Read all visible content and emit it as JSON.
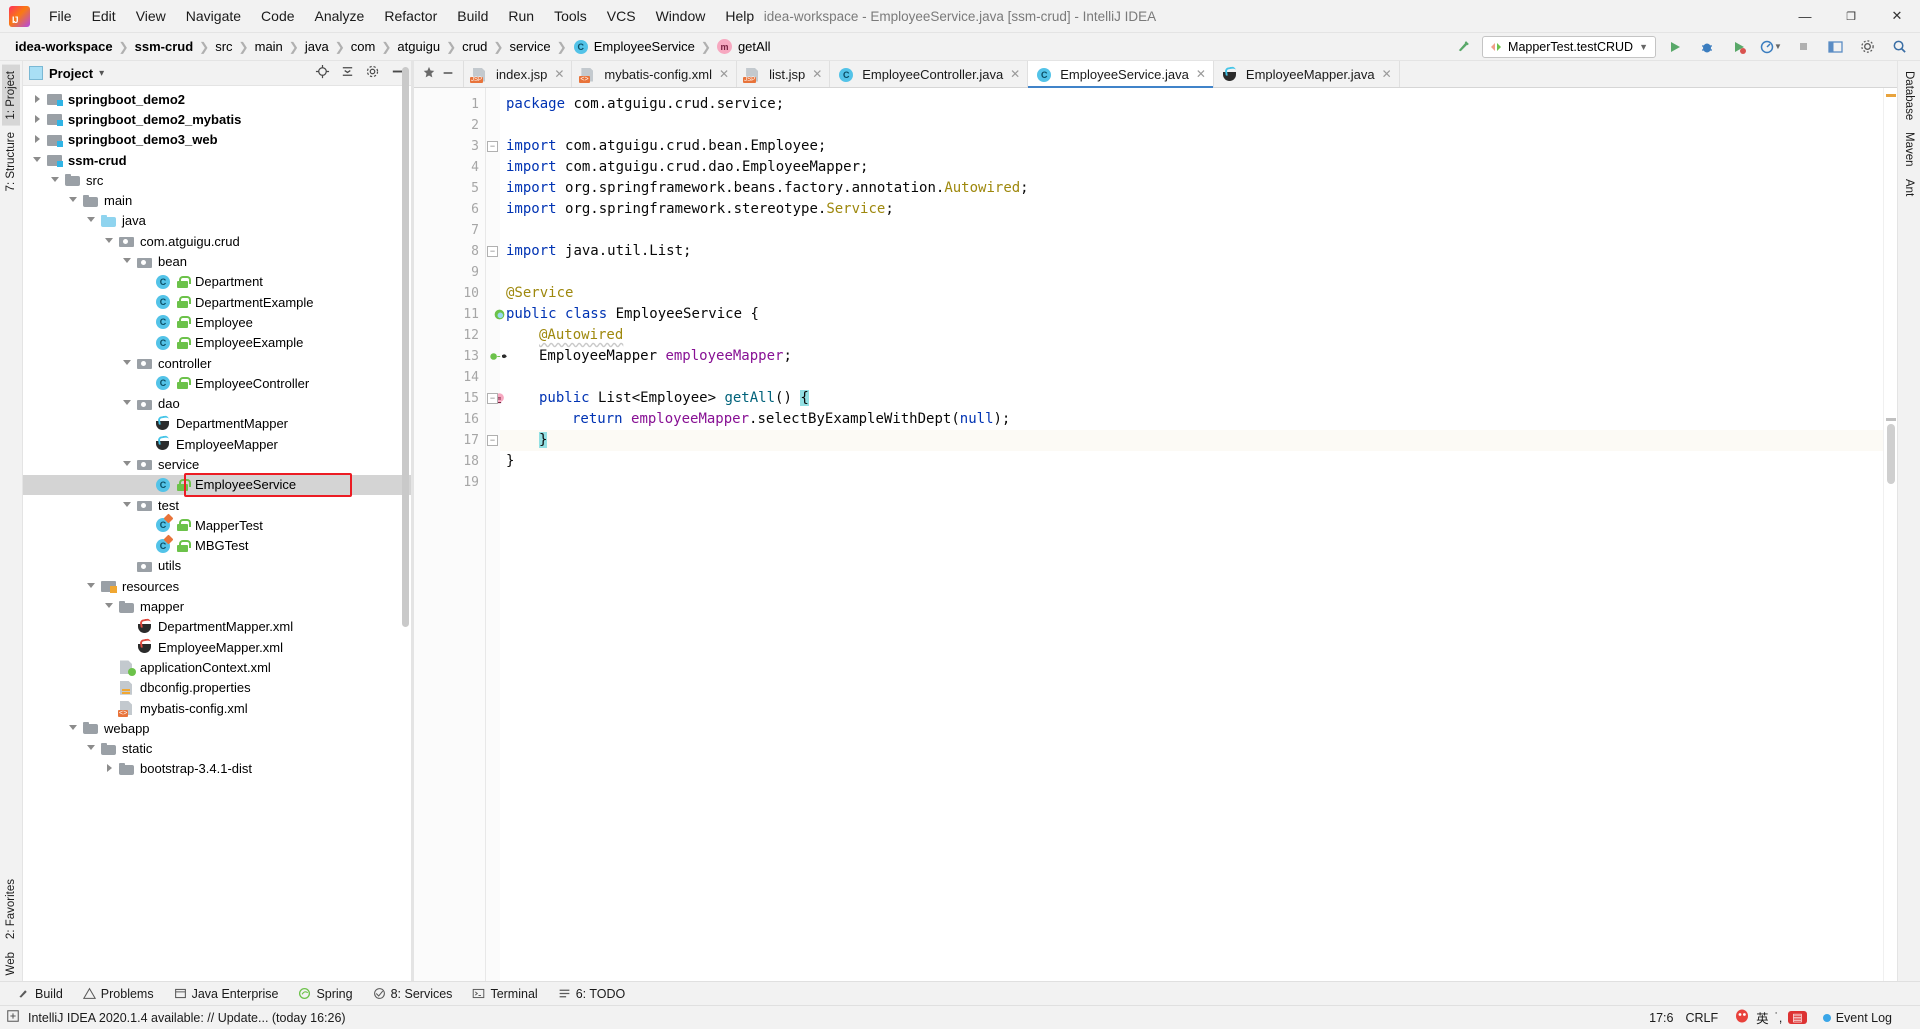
{
  "window": {
    "title": "idea-workspace - EmployeeService.java [ssm-crud] - IntelliJ IDEA",
    "minimize": "—",
    "maximize": "❐",
    "close": "✕"
  },
  "menu": [
    {
      "label": "File"
    },
    {
      "label": "Edit"
    },
    {
      "label": "View"
    },
    {
      "label": "Navigate"
    },
    {
      "label": "Code"
    },
    {
      "label": "Analyze"
    },
    {
      "label": "Refactor"
    },
    {
      "label": "Build"
    },
    {
      "label": "Run"
    },
    {
      "label": "Tools"
    },
    {
      "label": "VCS"
    },
    {
      "label": "Window"
    },
    {
      "label": "Help"
    }
  ],
  "breadcrumbs": [
    {
      "label": "idea-workspace",
      "bold": true
    },
    {
      "label": "ssm-crud",
      "bold": true
    },
    {
      "label": "src",
      "bold": false
    },
    {
      "label": "main",
      "bold": false
    },
    {
      "label": "java",
      "bold": false
    },
    {
      "label": "com",
      "bold": false
    },
    {
      "label": "atguigu",
      "bold": false
    },
    {
      "label": "crud",
      "bold": false
    },
    {
      "label": "service",
      "bold": false
    },
    {
      "label": "EmployeeService",
      "bold": false,
      "icon": "class-icon"
    },
    {
      "label": "getAll",
      "bold": false,
      "icon": "method-icon"
    }
  ],
  "toolbar": {
    "run_config": "MapperTest.testCRUD",
    "build_label": "build-icon",
    "run_label": "run-icon",
    "debug_label": "debug-icon",
    "coverage_label": "run-with-coverage-icon",
    "profile_label": "profiler-icon",
    "stop_label": "stop-icon",
    "layout_label": "layout-icon",
    "settings_label": "settings-icon",
    "search_label": "search-icon"
  },
  "left_strip": [
    {
      "label": "1: Project",
      "selected": true
    },
    {
      "label": "7: Structure",
      "selected": false
    },
    {
      "label": "2: Favorites",
      "selected": false
    },
    {
      "label": "Web",
      "selected": false
    }
  ],
  "right_strip": [
    {
      "label": "Database",
      "selected": false
    },
    {
      "label": "Maven",
      "selected": false
    },
    {
      "label": "Ant",
      "selected": false
    }
  ],
  "project_panel": {
    "title": "Project",
    "chevron": "▾",
    "locate_icon": "crosshair-icon",
    "collapse_icon": "collapse-all-icon",
    "settings_icon": "gear-icon",
    "hide_icon": "hide-icon",
    "tree": [
      {
        "label": "springboot_demo2",
        "depth": 1,
        "state": "closed",
        "icon": "module",
        "bold": true
      },
      {
        "label": "springboot_demo2_mybatis",
        "depth": 1,
        "state": "closed",
        "icon": "module",
        "bold": true
      },
      {
        "label": "springboot_demo3_web",
        "depth": 1,
        "state": "closed",
        "icon": "module",
        "bold": true
      },
      {
        "label": "ssm-crud",
        "depth": 1,
        "state": "open",
        "icon": "module",
        "bold": true
      },
      {
        "label": "src",
        "depth": 2,
        "state": "open",
        "icon": "folder"
      },
      {
        "label": "main",
        "depth": 3,
        "state": "open",
        "icon": "folder"
      },
      {
        "label": "java",
        "depth": 4,
        "state": "open",
        "icon": "folder-blue"
      },
      {
        "label": "com.atguigu.crud",
        "depth": 5,
        "state": "open",
        "icon": "package"
      },
      {
        "label": "bean",
        "depth": 6,
        "state": "open",
        "icon": "package"
      },
      {
        "label": "Department",
        "depth": 7,
        "state": "leaf",
        "icon": "class",
        "lock": true
      },
      {
        "label": "DepartmentExample",
        "depth": 7,
        "state": "leaf",
        "icon": "class",
        "lock": true
      },
      {
        "label": "Employee",
        "depth": 7,
        "state": "leaf",
        "icon": "class",
        "lock": true
      },
      {
        "label": "EmployeeExample",
        "depth": 7,
        "state": "leaf",
        "icon": "class",
        "lock": true
      },
      {
        "label": "controller",
        "depth": 6,
        "state": "open",
        "icon": "package"
      },
      {
        "label": "EmployeeController",
        "depth": 7,
        "state": "leaf",
        "icon": "class",
        "lock": true
      },
      {
        "label": "dao",
        "depth": 6,
        "state": "open",
        "icon": "package"
      },
      {
        "label": "DepartmentMapper",
        "depth": 7,
        "state": "leaf",
        "icon": "coffee"
      },
      {
        "label": "EmployeeMapper",
        "depth": 7,
        "state": "leaf",
        "icon": "coffee"
      },
      {
        "label": "service",
        "depth": 6,
        "state": "open",
        "icon": "package"
      },
      {
        "label": "EmployeeService",
        "depth": 7,
        "state": "leaf",
        "icon": "class",
        "lock": true,
        "selected": true,
        "highlight": true
      },
      {
        "label": "test",
        "depth": 6,
        "state": "open",
        "icon": "package"
      },
      {
        "label": "MapperTest",
        "depth": 7,
        "state": "leaf",
        "icon": "class-test",
        "lock": true
      },
      {
        "label": "MBGTest",
        "depth": 7,
        "state": "leaf",
        "icon": "class-test",
        "lock": true
      },
      {
        "label": "utils",
        "depth": 6,
        "state": "leaf",
        "icon": "package"
      },
      {
        "label": "resources",
        "depth": 4,
        "state": "open",
        "icon": "resources"
      },
      {
        "label": "mapper",
        "depth": 5,
        "state": "open",
        "icon": "folder"
      },
      {
        "label": "DepartmentMapper.xml",
        "depth": 6,
        "state": "leaf",
        "icon": "coffee-red"
      },
      {
        "label": "EmployeeMapper.xml",
        "depth": 6,
        "state": "leaf",
        "icon": "coffee-red"
      },
      {
        "label": "applicationContext.xml",
        "depth": 5,
        "state": "leaf",
        "icon": "xml-spring"
      },
      {
        "label": "dbconfig.properties",
        "depth": 5,
        "state": "leaf",
        "icon": "properties"
      },
      {
        "label": "mybatis-config.xml",
        "depth": 5,
        "state": "leaf",
        "icon": "xml"
      },
      {
        "label": "webapp",
        "depth": 3,
        "state": "open",
        "icon": "folder"
      },
      {
        "label": "static",
        "depth": 4,
        "state": "open",
        "icon": "folder"
      },
      {
        "label": "bootstrap-3.4.1-dist",
        "depth": 5,
        "state": "closed",
        "icon": "folder"
      }
    ]
  },
  "editor": {
    "tabs": [
      {
        "label": "index.jsp",
        "icon": "jsp-icon",
        "active": false
      },
      {
        "label": "mybatis-config.xml",
        "icon": "xml-icon",
        "active": false
      },
      {
        "label": "list.jsp",
        "icon": "jsp-icon",
        "active": false
      },
      {
        "label": "EmployeeController.java",
        "icon": "class-icon",
        "active": false
      },
      {
        "label": "EmployeeService.java",
        "icon": "class-icon",
        "active": true
      },
      {
        "label": "EmployeeMapper.java",
        "icon": "coffee-icon",
        "active": false
      }
    ],
    "tab_close": "✕",
    "pin_icon": "pin-icon",
    "hide_icon": "hide-icon",
    "caret_line": 17,
    "lines": [
      {
        "n": 1,
        "tokens": [
          {
            "t": "package ",
            "c": "kw"
          },
          {
            "t": "com.atguigu.crud.service;",
            "c": "plain"
          }
        ],
        "indent": 0
      },
      {
        "n": 2,
        "tokens": [],
        "indent": 0
      },
      {
        "n": 3,
        "tokens": [
          {
            "t": "import ",
            "c": "kw"
          },
          {
            "t": "com.atguigu.crud.bean.Employee;",
            "c": "plain"
          }
        ],
        "indent": 0,
        "fold": "minus"
      },
      {
        "n": 4,
        "tokens": [
          {
            "t": "import ",
            "c": "kw"
          },
          {
            "t": "com.atguigu.crud.dao.EmployeeMapper;",
            "c": "plain"
          }
        ],
        "indent": 0
      },
      {
        "n": 5,
        "tokens": [
          {
            "t": "import ",
            "c": "kw"
          },
          {
            "t": "org.springframework.beans.factory.annotation.",
            "c": "plain"
          },
          {
            "t": "Autowired",
            "c": "ann"
          },
          {
            "t": ";",
            "c": "plain"
          }
        ],
        "indent": 0
      },
      {
        "n": 6,
        "tokens": [
          {
            "t": "import ",
            "c": "kw"
          },
          {
            "t": "org.springframework.stereotype.",
            "c": "plain"
          },
          {
            "t": "Service",
            "c": "ann"
          },
          {
            "t": ";",
            "c": "plain"
          }
        ],
        "indent": 0
      },
      {
        "n": 7,
        "tokens": [],
        "indent": 0
      },
      {
        "n": 8,
        "tokens": [
          {
            "t": "import ",
            "c": "kw"
          },
          {
            "t": "java.util.List;",
            "c": "plain"
          }
        ],
        "indent": 0,
        "fold": "minus"
      },
      {
        "n": 9,
        "tokens": [],
        "indent": 0
      },
      {
        "n": 10,
        "tokens": [
          {
            "t": "@Service",
            "c": "ann"
          }
        ],
        "indent": 0
      },
      {
        "n": 11,
        "tokens": [
          {
            "t": "public ",
            "c": "kw"
          },
          {
            "t": "class ",
            "c": "kw"
          },
          {
            "t": "EmployeeService {",
            "c": "plain"
          }
        ],
        "indent": 0,
        "gmark": "bean-icon"
      },
      {
        "n": 12,
        "tokens": [
          {
            "t": "@Autowired",
            "c": "ann-u"
          }
        ],
        "indent": 1
      },
      {
        "n": 13,
        "tokens": [
          {
            "t": "EmployeeMapper ",
            "c": "plain"
          },
          {
            "t": "employeeMapper",
            "c": "fld"
          },
          {
            "t": ";",
            "c": "plain"
          }
        ],
        "indent": 1,
        "gmark": "autowired-icon"
      },
      {
        "n": 14,
        "tokens": [],
        "indent": 1
      },
      {
        "n": 15,
        "tokens": [
          {
            "t": "public ",
            "c": "kw"
          },
          {
            "t": "List<Employee> ",
            "c": "plain"
          },
          {
            "t": "getAll",
            "c": "mth"
          },
          {
            "t": "() ",
            "c": "plain"
          },
          {
            "t": "{",
            "c": "brace"
          }
        ],
        "indent": 1,
        "gmark": "method-icon",
        "fold": "minus"
      },
      {
        "n": 16,
        "tokens": [
          {
            "t": "return ",
            "c": "kw"
          },
          {
            "t": "employeeMapper",
            "c": "fld"
          },
          {
            "t": ".",
            "c": "plain"
          },
          {
            "t": "selectByExampleWithDept",
            "c": "plain"
          },
          {
            "t": "(",
            "c": "plain"
          },
          {
            "t": "null",
            "c": "kw"
          },
          {
            "t": ");",
            "c": "plain"
          }
        ],
        "indent": 2
      },
      {
        "n": 17,
        "tokens": [
          {
            "t": "}",
            "c": "brace"
          }
        ],
        "indent": 1,
        "fold": "minus"
      },
      {
        "n": 18,
        "tokens": [
          {
            "t": "}",
            "c": "plain"
          }
        ],
        "indent": 0
      },
      {
        "n": 19,
        "tokens": [],
        "indent": 0
      }
    ]
  },
  "bottom_bar": [
    {
      "label": "Build",
      "icon": "build-icon"
    },
    {
      "label": "Problems",
      "icon": "warning-icon"
    },
    {
      "label": "Java Enterprise",
      "icon": "java-ee-icon"
    },
    {
      "label": "Spring",
      "icon": "spring-icon"
    },
    {
      "label": "8: Services",
      "icon": "services-icon"
    },
    {
      "label": "Terminal",
      "icon": "terminal-icon"
    },
    {
      "label": "6: TODO",
      "icon": "todo-icon"
    }
  ],
  "status_bar": {
    "message": "IntelliJ IDEA 2020.1.4 available: // Update... (today 16:26)",
    "message_icon": "update-icon",
    "position": "17:6",
    "line_sep": "CRLF",
    "ime_lang": "英",
    "ime_mode": "˙,",
    "ime_icon": "sogou-icon",
    "event_log": "Event Log",
    "event_icon": "event-log-icon"
  }
}
